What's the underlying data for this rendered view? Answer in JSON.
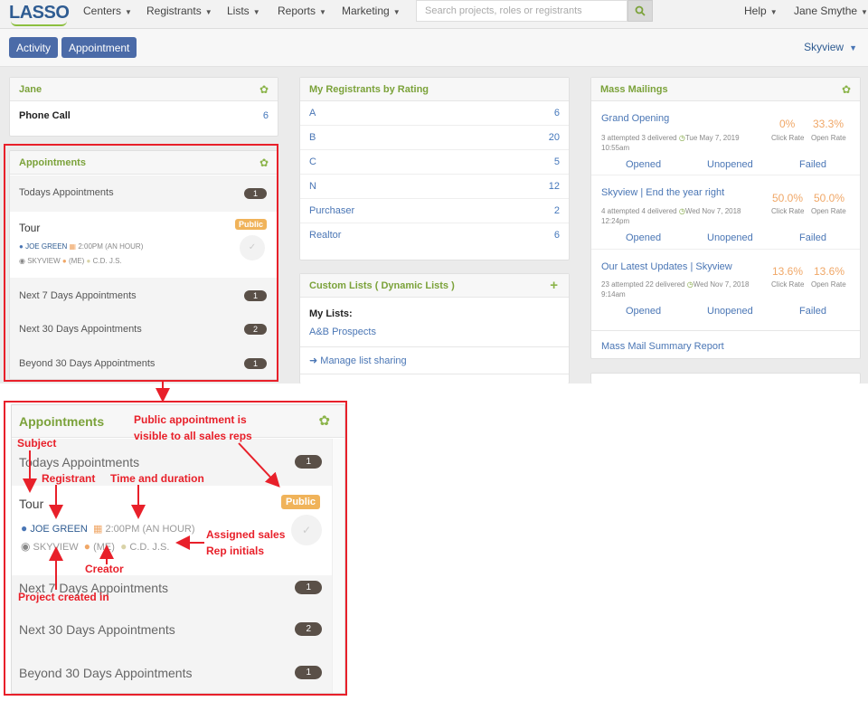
{
  "nav": {
    "logo": "LASSO",
    "menus": [
      "Centers",
      "Registrants",
      "Lists",
      "Reports",
      "Marketing"
    ],
    "search_placeholder": "Search projects, roles or registrants",
    "help": "Help",
    "user": "Jane Smythe"
  },
  "toolbar": {
    "activity": "Activity",
    "appointment": "Appointment",
    "project": "Skyview"
  },
  "jane": {
    "title": "Jane",
    "label": "Phone Call",
    "count": "6"
  },
  "appointments": {
    "title": "Appointments",
    "today": "Todays Appointments",
    "today_count": "1",
    "subject": "Tour",
    "public": "Public",
    "registrant": "JOE GREEN",
    "time": "2:00PM (AN HOUR)",
    "project": "SKYVIEW",
    "creator": "(ME)",
    "reps": "C.D. J.S.",
    "next7": "Next 7 Days Appointments",
    "next7_count": "1",
    "next30": "Next 30 Days Appointments",
    "next30_count": "2",
    "beyond": "Beyond 30 Days Appointments",
    "beyond_count": "1"
  },
  "ratings": {
    "title": "My Registrants by Rating",
    "rows": [
      {
        "label": "A",
        "count": "6"
      },
      {
        "label": "B",
        "count": "20"
      },
      {
        "label": "C",
        "count": "5"
      },
      {
        "label": "N",
        "count": "12"
      },
      {
        "label": "Purchaser",
        "count": "2"
      },
      {
        "label": "Realtor",
        "count": "6"
      }
    ]
  },
  "custom": {
    "title": "Custom Lists ( Dynamic Lists )",
    "my_lists": "My Lists:",
    "item": "A&B Prospects",
    "manage": "Manage list sharing"
  },
  "mass": {
    "title": "Mass Mailings",
    "click_label": "Click Rate",
    "open_label": "Open Rate",
    "opened": "Opened",
    "unopened": "Unopened",
    "failed": "Failed",
    "items": [
      {
        "name": "Grand Opening",
        "stats": "3 attempted 3 delivered",
        "date": "Tue May 7, 2019",
        "time": "10:55am",
        "click": "0%",
        "open": "33.3%"
      },
      {
        "name": "Skyview | End the year right",
        "stats": "4 attempted 4 delivered",
        "date": "Wed Nov 7, 2018",
        "time": "12:24pm",
        "click": "50.0%",
        "open": "50.0%"
      },
      {
        "name": "Our Latest Updates | Skyview",
        "stats": "23 attempted 22 delivered",
        "date": "Wed Nov 7, 2018",
        "time": "9:14am",
        "click": "13.6%",
        "open": "13.6%"
      }
    ],
    "report": "Mass Mail Summary Report"
  },
  "annotations": {
    "public": [
      "Public appointment is",
      "visible to all sales reps"
    ],
    "subject": "Subject",
    "registrant": "Registrant",
    "time": "Time and duration",
    "reps": [
      "Assigned sales",
      "Rep initials"
    ],
    "creator": "Creator",
    "project": "Project created in"
  },
  "colors": {
    "accent_green": "#7ba23a",
    "brand_blue": "#2f5c92",
    "button_blue": "#4b6ba8",
    "public_orange": "#f0b35a",
    "annotation_red": "#e8202a"
  }
}
